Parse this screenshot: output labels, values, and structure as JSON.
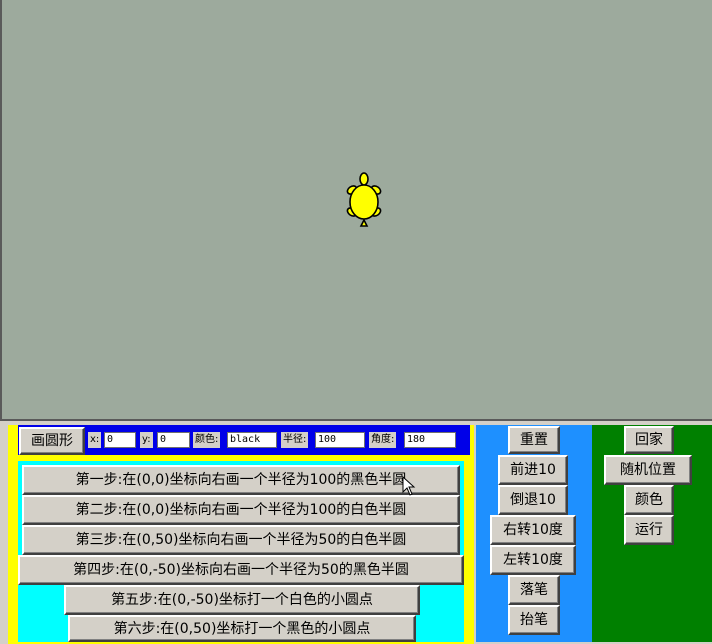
{
  "draw_circle": {
    "button_label": "画圆形",
    "x_label": "x:",
    "x_value": "0",
    "y_label": "y:",
    "y_value": "0",
    "color_label": "颜色:",
    "color_value": "black",
    "radius_label": "半径:",
    "radius_value": "100",
    "angle_label": "角度:",
    "angle_value": "180"
  },
  "steps": [
    "第一步:在(0,0)坐标向右画一个半径为100的黑色半圆",
    "第二步:在(0,0)坐标向右画一个半径为100的白色半圆",
    "第三步:在(0,50)坐标向右画一个半径为50的白色半圆",
    "第四步:在(0,-50)坐标向右画一个半径为50的黑色半圆",
    "第五步:在(0,-50)坐标打一个白色的小圆点",
    "第六步:在(0,50)坐标打一个黑色的小圆点"
  ],
  "controls": [
    "重置",
    "前进10",
    "倒退10",
    "右转10度",
    "左转10度",
    "落笔",
    "抬笔"
  ],
  "right_controls": [
    "回家",
    "随机位置",
    "颜色",
    "运行"
  ],
  "colors": {
    "canvas": "#9daa9d",
    "turtle": "#ffff00",
    "yellow_panel": "#ffff00",
    "blue_bar": "#0000e8",
    "cyan_panel": "#00ffff",
    "controls_panel": "#1e90ff",
    "right_panel": "#008000"
  },
  "icons": {
    "turtle": "turtle-icon",
    "cursor": "mouse-pointer-icon"
  }
}
